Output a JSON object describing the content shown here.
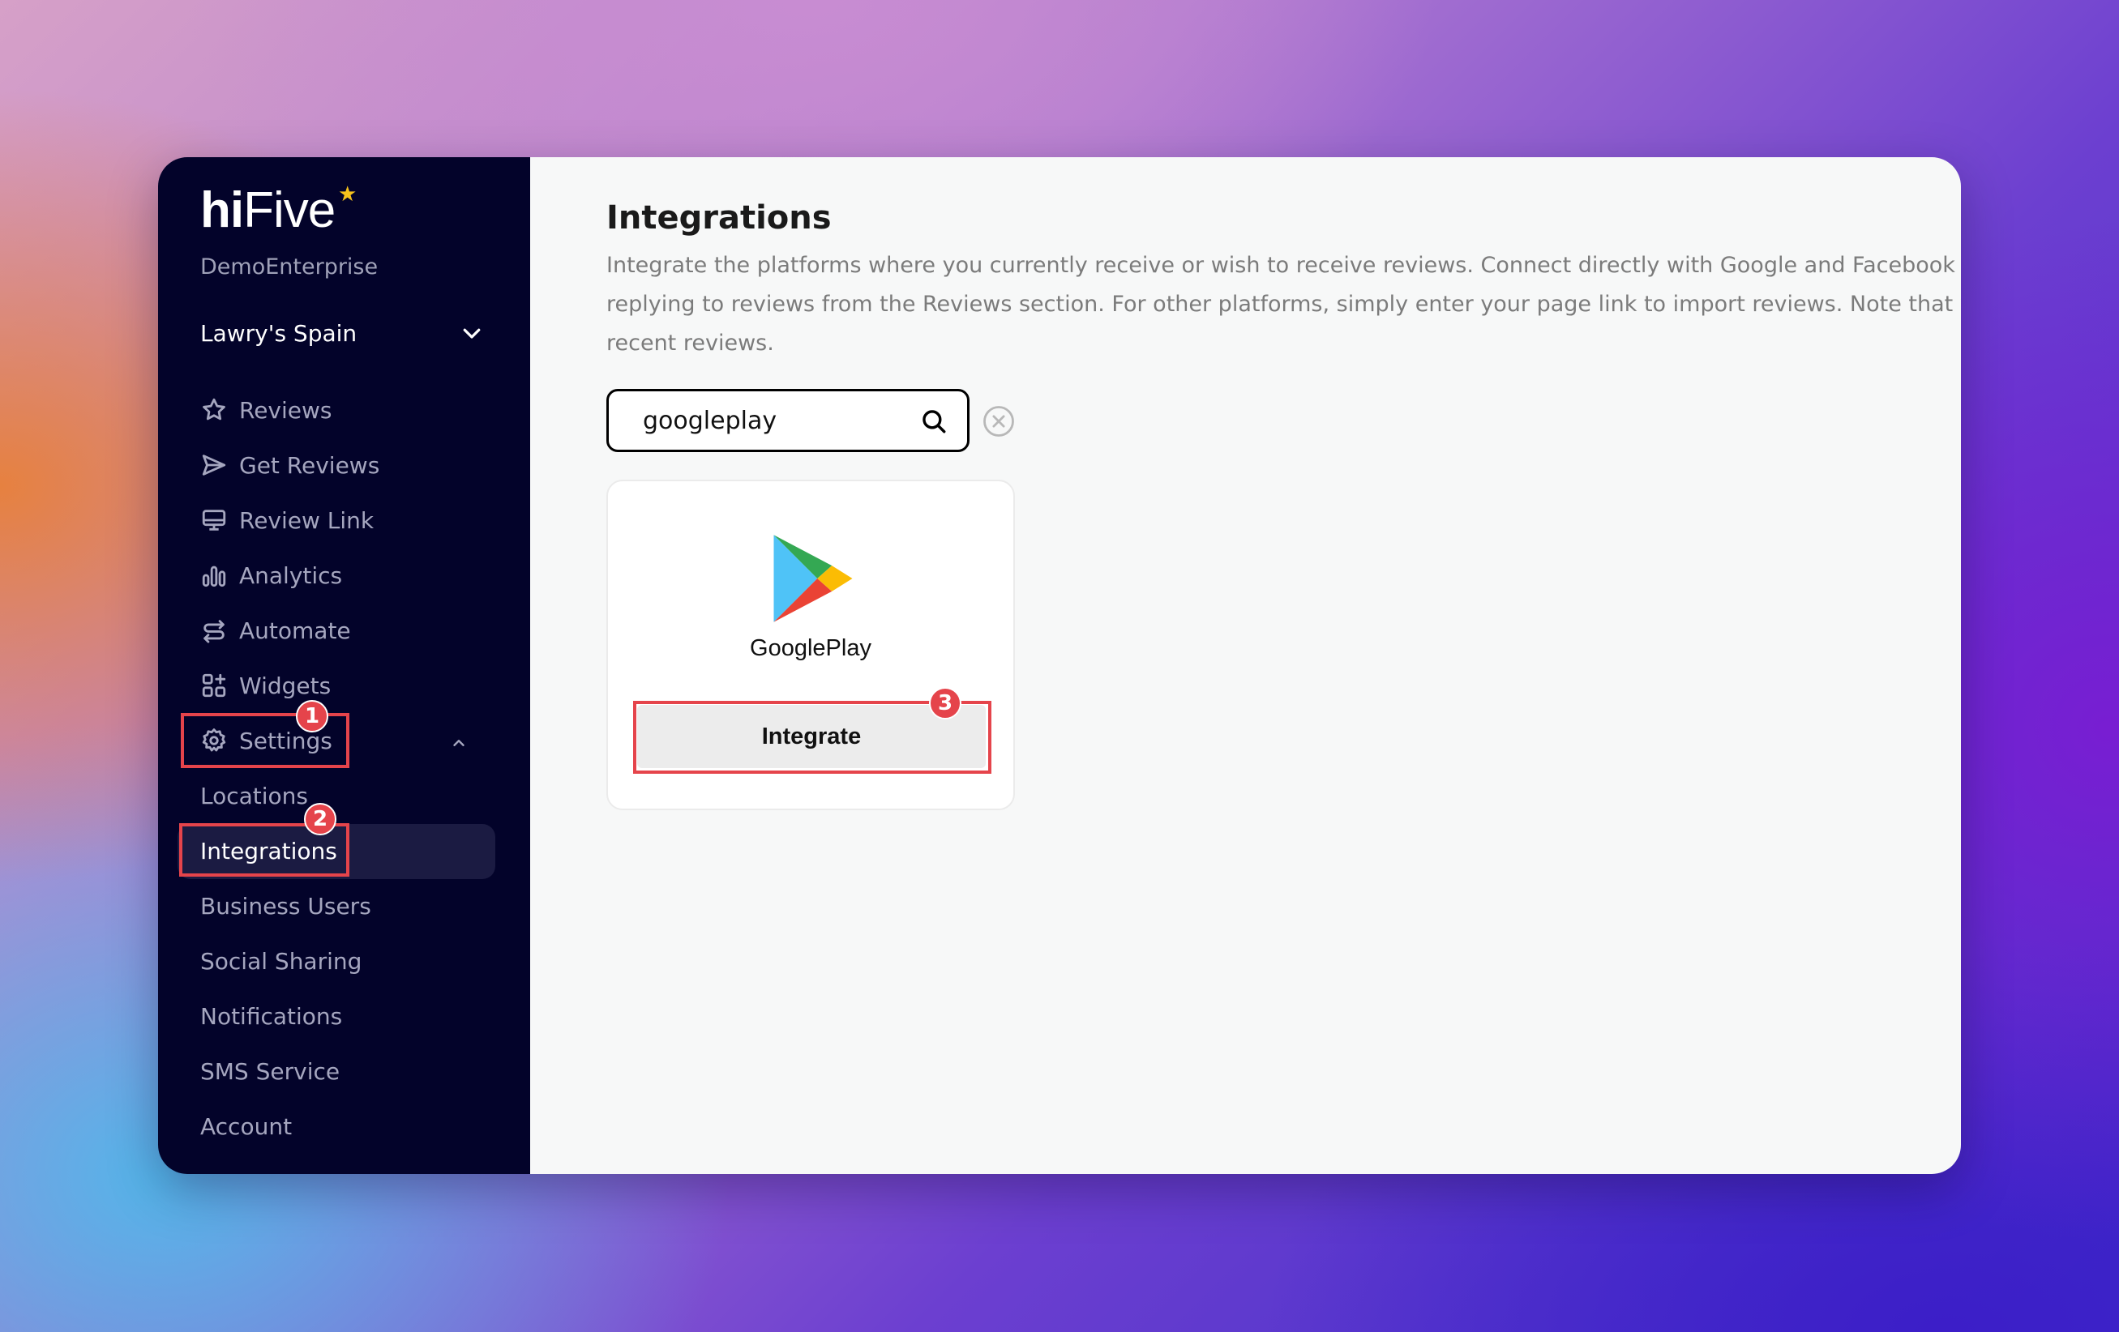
{
  "app": {
    "logo_prefix": "hi",
    "logo_suffix": "Five",
    "logo_star": "★",
    "organization": "DemoEnterprise",
    "location": "Lawry's Spain"
  },
  "sidebar": {
    "items": [
      {
        "label": "Reviews",
        "icon": "star-icon"
      },
      {
        "label": "Get Reviews",
        "icon": "send-icon"
      },
      {
        "label": "Review Link",
        "icon": "monitor-icon"
      },
      {
        "label": "Analytics",
        "icon": "bar-chart-icon"
      },
      {
        "label": "Automate",
        "icon": "automate-icon"
      },
      {
        "label": "Widgets",
        "icon": "widgets-icon"
      },
      {
        "label": "Settings",
        "icon": "gear-icon"
      }
    ],
    "settings_subitems": [
      {
        "label": "Locations"
      },
      {
        "label": "Integrations"
      },
      {
        "label": "Business Users"
      },
      {
        "label": "Social Sharing"
      },
      {
        "label": "Notifications"
      },
      {
        "label": "SMS Service"
      },
      {
        "label": "Account"
      }
    ]
  },
  "main": {
    "title": "Integrations",
    "description": "Integrate the platforms where you currently receive or wish to receive reviews. Connect directly with Google and Facebook via login to enable replying to reviews from the Reviews section. For other platforms, simply enter your page link to import reviews. Note that we only import the most recent reviews.",
    "search": {
      "value": "googleplay",
      "placeholder": ""
    },
    "cards": [
      {
        "name": "GooglePlay",
        "button_label": "Integrate"
      }
    ]
  },
  "annotations": {
    "badge1": "1",
    "badge2": "2",
    "badge3": "3"
  },
  "colors": {
    "sidebar_bg": "#03032a",
    "highlight": "#e5444b",
    "logo_star": "#f6c21c"
  }
}
